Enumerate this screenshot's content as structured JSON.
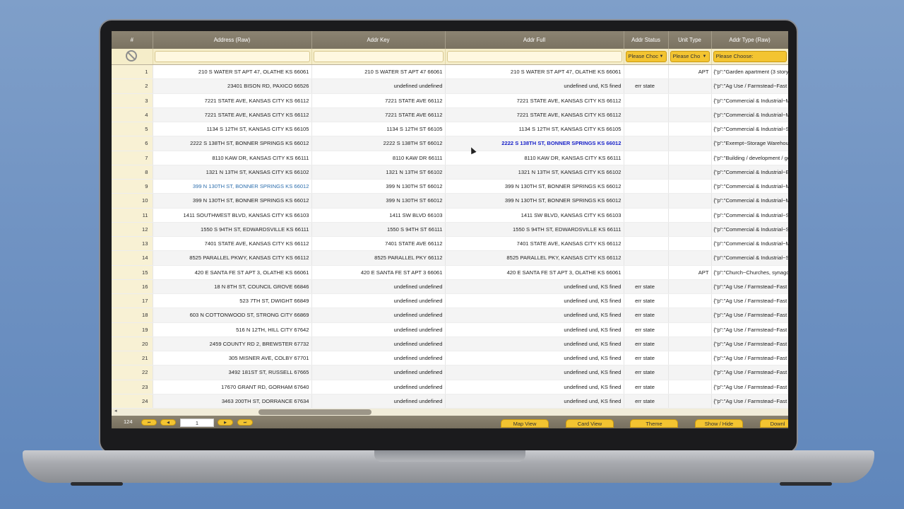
{
  "table": {
    "columns": [
      "#",
      "Address (Raw)",
      "Addr Key",
      "Addr Full",
      "Addr Status",
      "Unit Type",
      "Addr Type (Raw)"
    ],
    "filters": {
      "status": "Please Choc",
      "unit": "Please Cho",
      "type": "Please Choose:"
    },
    "rows": [
      {
        "n": "1",
        "raw": "210 S WATER ST APT 47, OLATHE KS 66061",
        "key": "210 S WATER ST APT 47 66061",
        "full": "210 S WATER ST APT 47, OLATHE KS 66061",
        "status": "",
        "unit": "APT",
        "type": "{\"p\":\"Garden apartment (3 story"
      },
      {
        "n": "2",
        "raw": "23401 BISON RD, PAXICO 66526",
        "key": "undefined undefined",
        "full": "undefined und, KS fined",
        "status": "err state",
        "unit": "",
        "type": "{\"p\":\"Ag Use / Farmstead~Fast f"
      },
      {
        "n": "3",
        "raw": "7221 STATE AVE, KANSAS CITY KS 66112",
        "key": "7221 STATE AVE 66112",
        "full": "7221 STATE AVE, KANSAS CITY KS 66112",
        "status": "",
        "unit": "",
        "type": "{\"p\":\"Commercial & Industrial~M"
      },
      {
        "n": "4",
        "raw": "7221 STATE AVE, KANSAS CITY KS 66112",
        "key": "7221 STATE AVE 66112",
        "full": "7221 STATE AVE, KANSAS CITY KS 66112",
        "status": "",
        "unit": "",
        "type": "{\"p\":\"Commercial & Industrial~M"
      },
      {
        "n": "5",
        "raw": "1134 S 12TH ST, KANSAS CITY KS 66105",
        "key": "1134 S 12TH ST 66105",
        "full": "1134 S 12TH ST, KANSAS CITY KS 66105",
        "status": "",
        "unit": "",
        "type": "{\"p\":\"Commercial & Industrial~St"
      },
      {
        "n": "6",
        "raw": "2222 S 138TH ST, BONNER SPRINGS KS 66012",
        "key": "2222 S 138TH ST 66012",
        "full": "2222 S 138TH ST, BONNER SPRINGS KS 66012",
        "status": "",
        "unit": "",
        "type": "{\"p\":\"Exempt~Storage Warehous"
      },
      {
        "n": "7",
        "raw": "8110 KAW DR, KANSAS CITY KS 66111",
        "key": "8110 KAW DR 66111",
        "full": "8110 KAW DR, KANSAS CITY KS 66111",
        "status": "",
        "unit": "",
        "type": "{\"p\":\"Building / development / ge"
      },
      {
        "n": "8",
        "raw": "1321 N 13TH ST, KANSAS CITY KS 66102",
        "key": "1321 N 13TH ST 66102",
        "full": "1321 N 13TH ST, KANSAS CITY KS 66102",
        "status": "",
        "unit": "",
        "type": "{\"p\":\"Commercial & Industrial~E"
      },
      {
        "n": "9",
        "raw": "399 N 130TH ST, BONNER SPRINGS KS 66012",
        "key": "399 N 130TH ST 66012",
        "full": "399 N 130TH ST, BONNER SPRINGS KS 66012",
        "status": "",
        "unit": "",
        "type": "{\"p\":\"Commercial & Industrial~M"
      },
      {
        "n": "10",
        "raw": "399 N 130TH ST, BONNER SPRINGS KS 66012",
        "key": "399 N 130TH ST 66012",
        "full": "399 N 130TH ST, BONNER SPRINGS KS 66012",
        "status": "",
        "unit": "",
        "type": "{\"p\":\"Commercial & Industrial~M"
      },
      {
        "n": "11",
        "raw": "1411 SOUTHWEST BLVD, KANSAS CITY KS 66103",
        "key": "1411 SW BLVD 66103",
        "full": "1411 SW BLVD, KANSAS CITY KS 66103",
        "status": "",
        "unit": "",
        "type": "{\"p\":\"Commercial & Industrial~S"
      },
      {
        "n": "12",
        "raw": "1550 S 94TH ST, EDWARDSVILLE KS 66111",
        "key": "1550 S 94TH ST 66111",
        "full": "1550 S 94TH ST, EDWARDSVILLE KS 66111",
        "status": "",
        "unit": "",
        "type": "{\"p\":\"Commercial & Industrial~S"
      },
      {
        "n": "13",
        "raw": "7401 STATE AVE, KANSAS CITY KS 66112",
        "key": "7401 STATE AVE 66112",
        "full": "7401 STATE AVE, KANSAS CITY KS 66112",
        "status": "",
        "unit": "",
        "type": "{\"p\":\"Commercial & Industrial~M"
      },
      {
        "n": "14",
        "raw": "8525 PARALLEL PKWY, KANSAS CITY KS 66112",
        "key": "8525 PARALLEL PKY 66112",
        "full": "8525 PARALLEL PKY, KANSAS CITY KS 66112",
        "status": "",
        "unit": "",
        "type": "{\"p\":\"Commercial & Industrial~S"
      },
      {
        "n": "15",
        "raw": "420 E SANTA FE ST APT 3, OLATHE KS 66061",
        "key": "420 E SANTA FE ST APT 3 66061",
        "full": "420 E SANTA FE ST APT 3, OLATHE KS 66061",
        "status": "",
        "unit": "APT",
        "type": "{\"p\":\"Church~Churches, synago"
      },
      {
        "n": "16",
        "raw": "18 N 8TH ST, COUNCIL GROVE 66846",
        "key": "undefined undefined",
        "full": "undefined und, KS fined",
        "status": "err state",
        "unit": "",
        "type": "{\"p\":\"Ag Use / Farmstead~Fast f"
      },
      {
        "n": "17",
        "raw": "523 7TH ST, DWIGHT 66849",
        "key": "undefined undefined",
        "full": "undefined und, KS fined",
        "status": "err state",
        "unit": "",
        "type": "{\"p\":\"Ag Use / Farmstead~Fast f"
      },
      {
        "n": "18",
        "raw": "603 N COTTONWOOD ST, STRONG CITY 66869",
        "key": "undefined undefined",
        "full": "undefined und, KS fined",
        "status": "err state",
        "unit": "",
        "type": "{\"p\":\"Ag Use / Farmstead~Fast f"
      },
      {
        "n": "19",
        "raw": "516 N 12TH, HILL CITY 67642",
        "key": "undefined undefined",
        "full": "undefined und, KS fined",
        "status": "err state",
        "unit": "",
        "type": "{\"p\":\"Ag Use / Farmstead~Fast f"
      },
      {
        "n": "20",
        "raw": "2459 COUNTY RD 2, BREWSTER 67732",
        "key": "undefined undefined",
        "full": "undefined und, KS fined",
        "status": "err state",
        "unit": "",
        "type": "{\"p\":\"Ag Use / Farmstead~Fast f"
      },
      {
        "n": "21",
        "raw": "305 MISNER AVE, COLBY 67701",
        "key": "undefined undefined",
        "full": "undefined und, KS fined",
        "status": "err state",
        "unit": "",
        "type": "{\"p\":\"Ag Use / Farmstead~Fast f"
      },
      {
        "n": "22",
        "raw": "3492 181ST ST, RUSSELL 67665",
        "key": "undefined undefined",
        "full": "undefined und, KS fined",
        "status": "err state",
        "unit": "",
        "type": "{\"p\":\"Ag Use / Farmstead~Fast f"
      },
      {
        "n": "23",
        "raw": "17670 GRANT RD, GORHAM 67640",
        "key": "undefined undefined",
        "full": "undefined und, KS fined",
        "status": "err state",
        "unit": "",
        "type": "{\"p\":\"Ag Use / Farmstead~Fast f"
      },
      {
        "n": "24",
        "raw": "3463 200TH ST, DORRANCE 67634",
        "key": "undefined undefined",
        "full": "undefined und, KS fined",
        "status": "err state",
        "unit": "",
        "type": "{\"p\":\"Ag Use / Farmstead~Fast f"
      }
    ]
  },
  "footer": {
    "count": "124",
    "page": "1",
    "map_view": "Map View",
    "card_view": "Card View",
    "theme": "Theme",
    "show_hide": "Show / Hide",
    "download": "Downl"
  },
  "icons": {
    "first": "⏮",
    "prev": "◀",
    "next": "▶",
    "last": "⏭",
    "clear_filter": "no-entry-icon",
    "scroll_left": "◂"
  },
  "colors": {
    "header": "#7a7261",
    "accent": "#f3c431",
    "row_number_bg": "#f8f1d4",
    "highlight_blue": "#2e6fae",
    "highlight_bold": "#1a23c9"
  }
}
